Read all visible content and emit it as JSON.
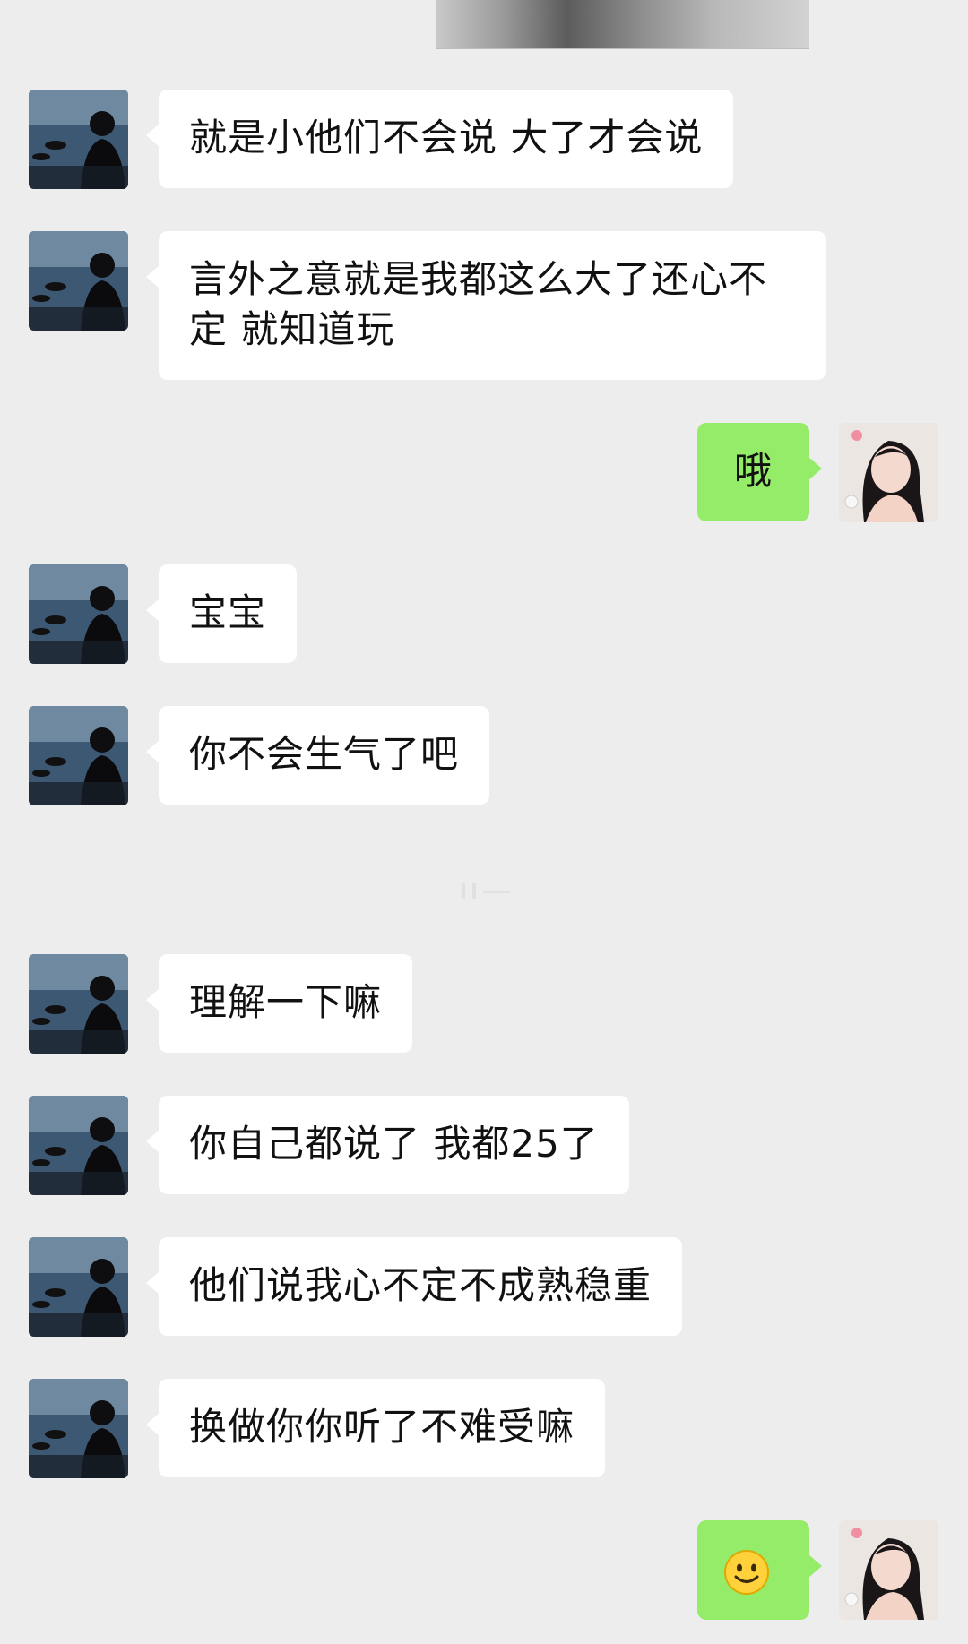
{
  "messages": [
    {
      "side": "in",
      "text": "就是小他们不会说 大了才会说"
    },
    {
      "side": "in",
      "text": "言外之意就是我都这么大了还心不定 就知道玩"
    },
    {
      "side": "out",
      "text": "哦"
    },
    {
      "side": "in",
      "text": "宝宝"
    },
    {
      "side": "in",
      "text": "你不会生气了吧"
    },
    {
      "side": "in",
      "text": "理解一下嘛"
    },
    {
      "side": "in",
      "text": "你自己都说了 我都25了"
    },
    {
      "side": "in",
      "text": "他们说我心不定不成熟稳重"
    },
    {
      "side": "in",
      "text": "换做你你听了不难受嘛"
    },
    {
      "side": "out",
      "emoji": "smile-emoji"
    }
  ]
}
